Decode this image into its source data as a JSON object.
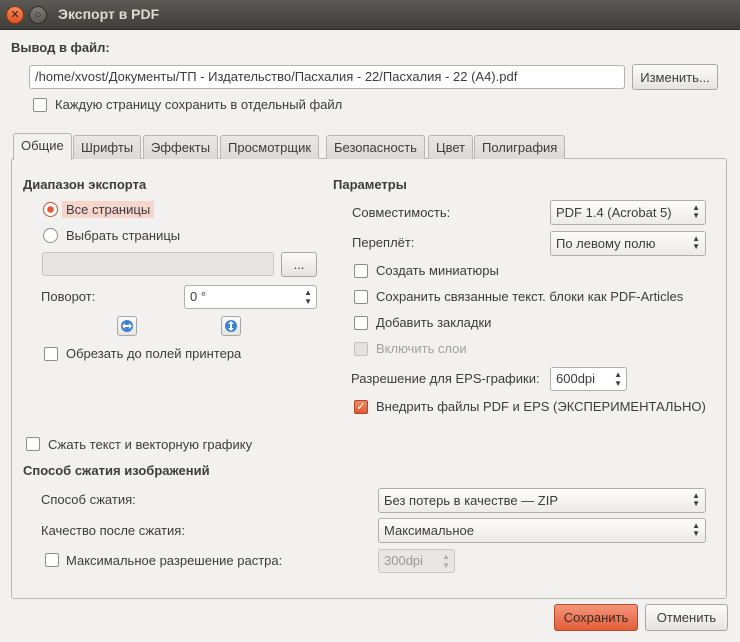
{
  "window": {
    "title": "Экспорт в PDF",
    "close_glyph": "✕",
    "maximize_glyph": "○"
  },
  "output": {
    "section_label": "Вывод в файл:",
    "path_value": "/home/xvost/Документы/ТП - Издательство/Пасхалия - 22/Пасхалия - 22 (A4).pdf",
    "change_button": "Изменить...",
    "separate_pages_label": "Каждую страницу сохранить в отдельный файл",
    "separate_pages_checked": false
  },
  "tabs": [
    {
      "label": "Общие",
      "active": true
    },
    {
      "label": "Шрифты",
      "active": false
    },
    {
      "label": "Эффекты",
      "active": false
    },
    {
      "label": "Просмотрщик",
      "active": false
    },
    {
      "label": "Безопасность",
      "active": false
    },
    {
      "label": "Цвет",
      "active": false
    },
    {
      "label": "Полиграфия",
      "active": false
    }
  ],
  "export_range": {
    "heading": "Диапазон экспорта",
    "all_pages_label": "Все страницы",
    "all_pages_selected": true,
    "select_pages_label": "Выбрать страницы",
    "select_pages_selected": false,
    "pages_value": "",
    "browse_button": "...",
    "rotation_label": "Поворот:",
    "rotation_value": "0 °",
    "clip_label": "Обрезать до полей принтера",
    "clip_checked": false
  },
  "params": {
    "heading": "Параметры",
    "compat_label": "Совместимость:",
    "compat_value": "PDF 1.4 (Acrobat 5)",
    "binding_label": "Переплёт:",
    "binding_value": "По левому полю",
    "thumbnails_label": "Создать миниатюры",
    "thumbnails_checked": false,
    "articles_label": "Сохранить связанные текст. блоки как PDF-Articles",
    "articles_checked": false,
    "bookmarks_label": "Добавить закладки",
    "bookmarks_checked": false,
    "layers_label": "Включить слои",
    "layers_checked": false,
    "eps_res_label": "Разрешение для EPS-графики:",
    "eps_res_value": "600dpi",
    "embed_label": "Внедрить файлы PDF и EPS (ЭКСПЕРИМЕНТАЛЬНО)",
    "embed_checked": true
  },
  "compression": {
    "compress_text_label": "Сжать текст и векторную графику",
    "compress_text_checked": false,
    "heading": "Способ сжатия изображений",
    "method_label": "Способ сжатия:",
    "method_value": "Без потерь в качестве — ZIP",
    "quality_label": "Качество после сжатия:",
    "quality_value": "Максимальное",
    "max_res_label": "Максимальное разрешение растра:",
    "max_res_checked": false,
    "max_res_value": "300dpi"
  },
  "footer": {
    "save_button": "Сохранить",
    "cancel_button": "Отменить"
  },
  "glyphs": {
    "combo_arrows": "▲▼",
    "check": "✓"
  }
}
